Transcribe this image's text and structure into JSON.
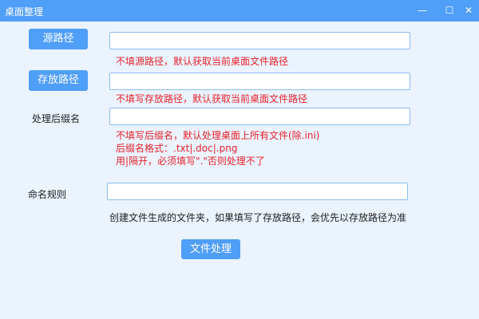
{
  "window": {
    "title": "桌面整理",
    "minimize": "—",
    "maximize": "☐",
    "close": "✕"
  },
  "source": {
    "button": "源路径",
    "value": "",
    "hint": "不填源路径，默认获取当前桌面文件路径"
  },
  "target": {
    "button": "存放路径",
    "value": "",
    "hint": "不填写存放路径，默认获取当前桌面文件路径"
  },
  "suffix": {
    "label": "处理后缀名",
    "value": "",
    "hints": [
      "不填写后缀名，默认处理桌面上所有文件(除.ini)",
      "后缀名格式：.txt|.doc|.png",
      "用|隔开，必须填写\".\"否则处理不了"
    ]
  },
  "naming": {
    "label": "命名规则",
    "value": "",
    "note": "创建文件生成的文件夹，如果填写了存放路径，会优先以存放路径为准"
  },
  "process_button": "文件处理"
}
